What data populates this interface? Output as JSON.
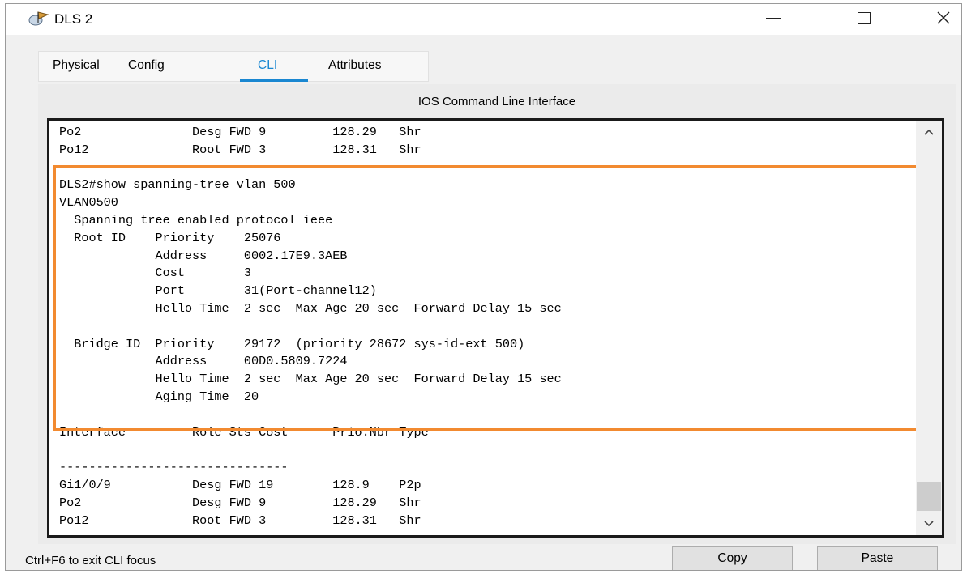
{
  "window": {
    "title": "DLS 2"
  },
  "tabs": [
    {
      "label": "Physical"
    },
    {
      "label": "Config"
    },
    {
      "label": "CLI"
    },
    {
      "label": "Attributes"
    }
  ],
  "active_tab": "CLI",
  "panel": {
    "title": "IOS Command Line Interface"
  },
  "terminal": {
    "text": "Po2               Desg FWD 9         128.29   Shr\nPo12              Root FWD 3         128.31   Shr\n\nDLS2#show spanning-tree vlan 500\nVLAN0500\n  Spanning tree enabled protocol ieee\n  Root ID    Priority    25076\n             Address     0002.17E9.3AEB\n             Cost        3\n             Port        31(Port-channel12)\n             Hello Time  2 sec  Max Age 20 sec  Forward Delay 15 sec\n\n  Bridge ID  Priority    29172  (priority 28672 sys-id-ext 500)\n             Address     00D0.5809.7224\n             Hello Time  2 sec  Max Age 20 sec  Forward Delay 15 sec\n             Aging Time  20\n\nInterface         Role Sts Cost      Prio.Nbr Type\n\n-------------------------------\nGi1/0/9           Desg FWD 19        128.9    P2p\nPo2               Desg FWD 9         128.29   Shr\nPo12              Root FWD 3         128.31   Shr\n\nDLS2#"
  },
  "footer": {
    "hint": "Ctrl+F6 to exit CLI focus",
    "copy_label": "Copy",
    "paste_label": "Paste"
  },
  "colors": {
    "accent": "#1a87d1",
    "highlight": "#f28a30"
  },
  "icons": {
    "app": "packet-tracer-device-icon",
    "minimize": "minimize-icon",
    "maximize": "maximize-icon",
    "close": "close-icon",
    "scroll_up": "chevron-up-icon",
    "scroll_down": "chevron-down-icon"
  }
}
